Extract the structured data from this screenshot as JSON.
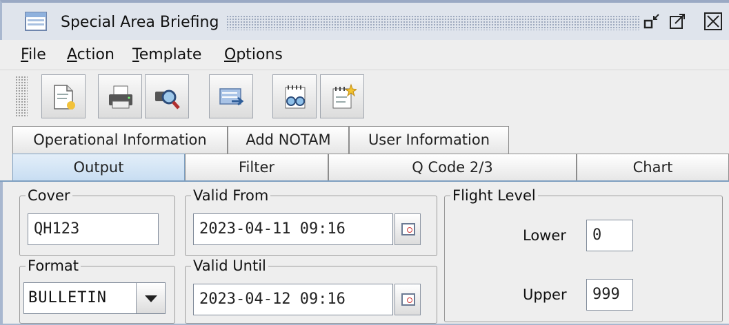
{
  "window": {
    "title": "Special Area Briefing"
  },
  "menu": [
    "File",
    "Action",
    "Template",
    "Options"
  ],
  "menu_mnemonics": [
    "F",
    "A",
    "T",
    "O"
  ],
  "toolbar_icons": [
    "new-document-icon",
    "print-icon",
    "print-preview-icon",
    "send-icon",
    "view-notam-icon",
    "new-notam-icon"
  ],
  "tabs_top": [
    "Operational Information",
    "Add NOTAM",
    "User Information"
  ],
  "tabs_bottom": [
    "Output",
    "Filter",
    "Q Code 2/3",
    "Chart"
  ],
  "selected_tab": "Output",
  "cover": {
    "label": "Cover",
    "value": "QH123"
  },
  "format": {
    "label": "Format",
    "value": "BULLETIN"
  },
  "valid_from": {
    "label": "Valid From",
    "value": "2023-04-11 09:16"
  },
  "valid_until": {
    "label": "Valid Until",
    "value": "2023-04-12 09:16"
  },
  "flight_level": {
    "label": "Flight Level",
    "lower_label": "Lower",
    "lower_value": "0",
    "upper_label": "Upper",
    "upper_value": "999"
  },
  "colors": {
    "selected_tab": "#c7ddf2",
    "frame": "#a8b7cf"
  }
}
